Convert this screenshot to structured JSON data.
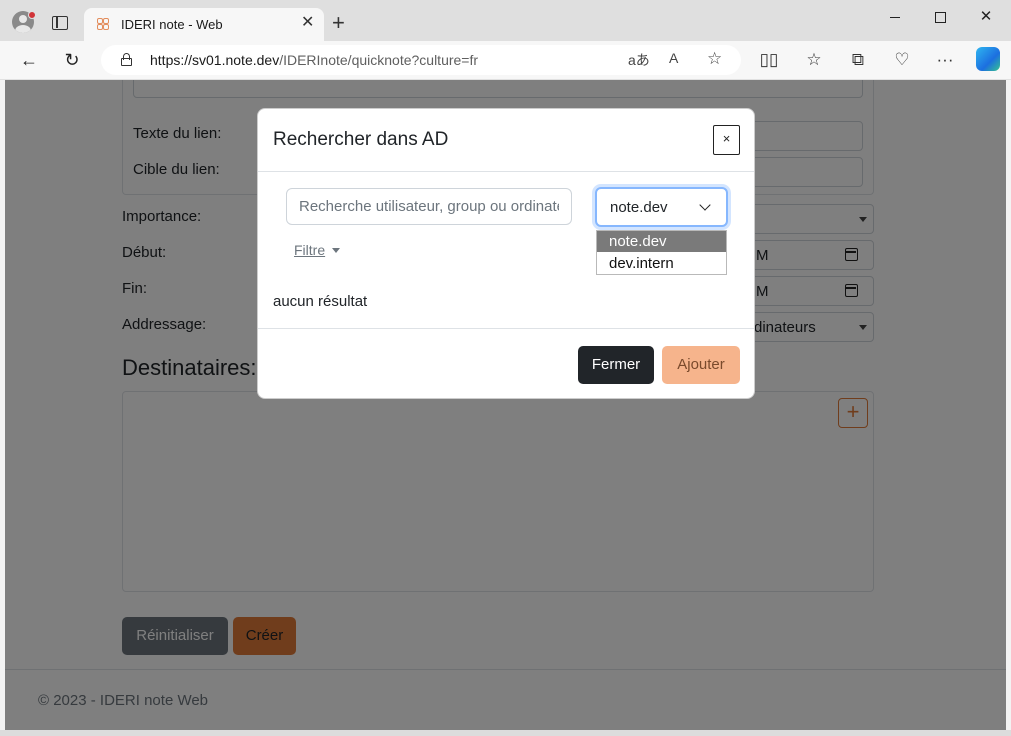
{
  "browser": {
    "tab_title": "IDERI note - Web",
    "url_host": "https://sv01.note.dev",
    "url_path": "/IDERInote/quicknote?culture=fr",
    "new_tab_label": "+"
  },
  "form": {
    "link_text_label": "Texte du lien:",
    "link_target_label": "Cible du lien:",
    "importance_label": "Importance:",
    "start_label": "Début:",
    "end_label": "Fin:",
    "addressing_label": "Addressage:",
    "start_value_tail": "M",
    "end_value_tail": "M",
    "addressing_value_tail": "dinateurs",
    "recipients_heading": "Destinataires:",
    "add_recipient": "+",
    "reset_button": "Réinitialiser",
    "create_button": "Créer"
  },
  "footer": {
    "text": "© 2023 - IDERI note Web"
  },
  "modal": {
    "title": "Rechercher dans AD",
    "close_label": "×",
    "search_placeholder": "Recherche utilisateur, group ou ordinateur",
    "domain_selected": "note.dev",
    "domain_options": [
      "note.dev",
      "dev.intern"
    ],
    "filter_label": "Filtre",
    "no_result": "aucun résultat",
    "close_button": "Fermer",
    "add_button": "Ajouter"
  },
  "colors": {
    "accent": "#e07b39",
    "dark_button": "#212529",
    "secondary_button": "#6c757d",
    "focus_ring": "#86b7fe"
  }
}
